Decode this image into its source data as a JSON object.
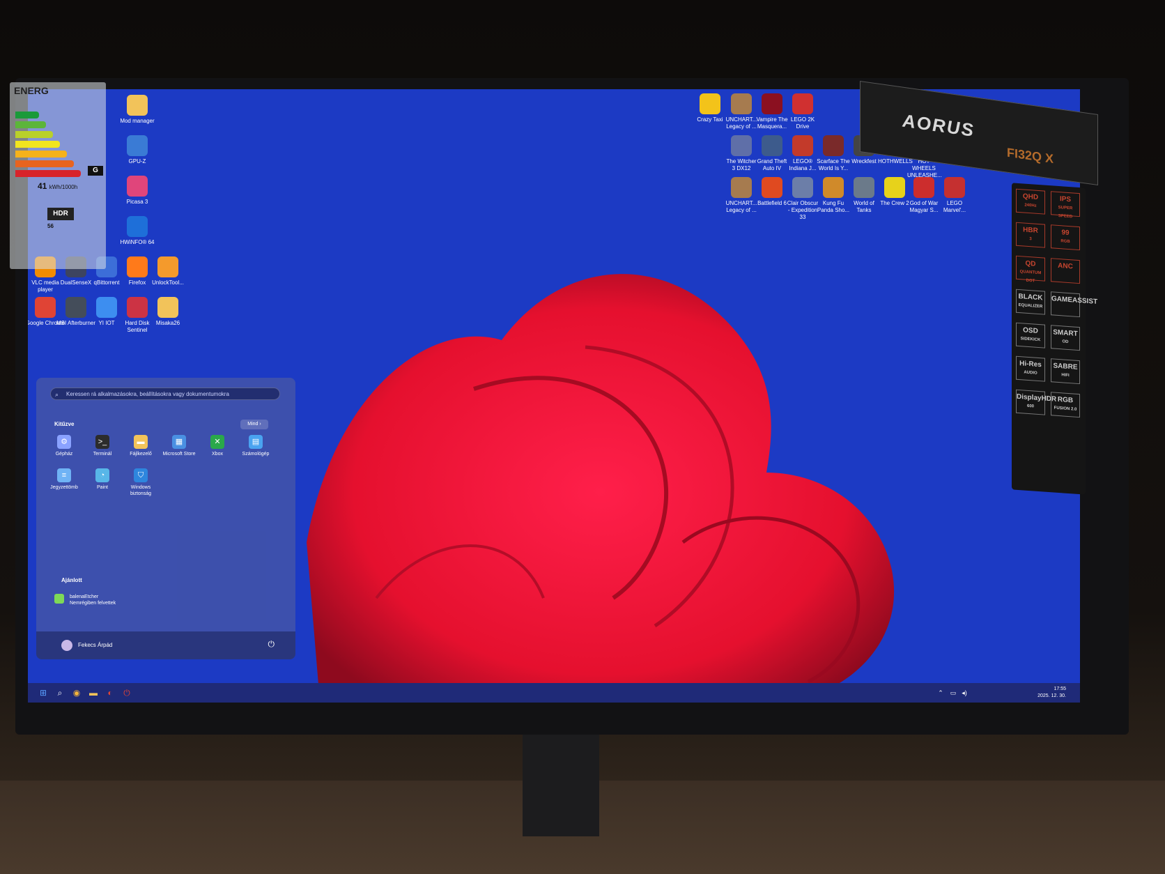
{
  "desktop_icons_left": [
    {
      "label": "Mod manager",
      "icon": "folder-icon",
      "color": "#f2c35a"
    },
    {
      "label": "GPU-Z",
      "icon": "gpuz-icon",
      "color": "#3a7bd5"
    },
    {
      "label": "Picasa 3",
      "icon": "picasa-icon",
      "color": "#e0457b"
    },
    {
      "label": "HWiNFO® 64",
      "icon": "hwinfo-icon",
      "color": "#1e6fd9"
    },
    {
      "label": "VLC media player",
      "icon": "vlc-icon",
      "color": "#f28c00"
    },
    {
      "label": "DualSenseX",
      "icon": "controller-icon",
      "color": "#3d4460"
    },
    {
      "label": "qBittorrent",
      "icon": "qbittorrent-icon",
      "color": "#3c6ed8"
    },
    {
      "label": "Firefox",
      "icon": "firefox-icon",
      "color": "#ff7a1a"
    },
    {
      "label": "UnlockTool...",
      "icon": "unlocktool-icon",
      "color": "#f49a2c"
    },
    {
      "label": "Google Chrome",
      "icon": "chrome-icon",
      "color": "#e04435"
    },
    {
      "label": "MSI Afterburner",
      "icon": "msi-icon",
      "color": "#444d5a"
    },
    {
      "label": "YI IOT",
      "icon": "yiiot-icon",
      "color": "#3d8ef0"
    },
    {
      "label": "Hard Disk Sentinel",
      "icon": "harddisk-icon",
      "color": "#cc3344"
    },
    {
      "label": "Misaka26",
      "icon": "folder-icon",
      "color": "#f2c35a"
    }
  ],
  "desktop_icons_right": [
    {
      "label": "Crazy Taxi",
      "color": "#f3c31a"
    },
    {
      "label": "UNCHART... Legacy of ...",
      "color": "#a67b4f"
    },
    {
      "label": "Vampire The Masquera...",
      "color": "#8b1020"
    },
    {
      "label": "LEGO 2K Drive",
      "color": "#d03030"
    },
    {
      "label": "The Witcher 3 DX12",
      "color": "#5f6fa8"
    },
    {
      "label": "Grand Theft Auto IV",
      "color": "#3d5b8c"
    },
    {
      "label": "LEGO® Indiana J...",
      "color": "#c33a2a"
    },
    {
      "label": "Scarface The World Is Y...",
      "color": "#7a2a2a"
    },
    {
      "label": "Wreckfest",
      "color": "#444"
    },
    {
      "label": "HOTHWELLS",
      "color": "#444"
    },
    {
      "label": "HOT WHEELS UNLEASHE...",
      "color": "#444"
    },
    {
      "label": "UNCHART... Legacy of ...",
      "color": "#a67b4f"
    },
    {
      "label": "Battlefield 6",
      "color": "#e04a20"
    },
    {
      "label": "Clair Obscur - Expedition 33",
      "color": "#6c7ea8"
    },
    {
      "label": "Kung Fu Panda Sho...",
      "color": "#d08a2a"
    },
    {
      "label": "World of Tanks",
      "color": "#6b7a8a"
    },
    {
      "label": "The Crew 2",
      "color": "#e7d21b"
    },
    {
      "label": "God of War Magyar S...",
      "color": "#cc2d2d"
    },
    {
      "label": "LEGO Marvel'...",
      "color": "#c53030"
    }
  ],
  "start_menu": {
    "search_placeholder": "Keressen rá alkalmazásokra, beállításokra vagy dokumentumokra",
    "pinned_title": "Kitűzve",
    "all_label": "Mind",
    "pinned": [
      {
        "label": "Gépház",
        "icon": "settings-icon",
        "glyph": "⚙",
        "color": "#8aa2ff"
      },
      {
        "label": "Terminál",
        "icon": "terminal-icon",
        "glyph": ">_",
        "color": "#2c2c2c"
      },
      {
        "label": "Fájlkezelő",
        "icon": "folder-icon",
        "glyph": "▬",
        "color": "#f2c35a"
      },
      {
        "label": "Microsoft Store",
        "icon": "store-icon",
        "glyph": "▦",
        "color": "#4a90e2"
      },
      {
        "label": "Xbox",
        "icon": "xbox-icon",
        "glyph": "✕",
        "color": "#2aa84a"
      },
      {
        "label": "Számológép",
        "icon": "calculator-icon",
        "glyph": "▤",
        "color": "#4aa3f0"
      },
      {
        "label": "Jegyzettömb",
        "icon": "notepad-icon",
        "glyph": "≡",
        "color": "#6fb3f5"
      },
      {
        "label": "Paint",
        "icon": "paint-icon",
        "glyph": "◔",
        "color": "#58b6e8"
      },
      {
        "label": "Windows biztonság",
        "icon": "shield-icon",
        "glyph": "⛉",
        "color": "#2e86de"
      }
    ],
    "recommended_title": "Ajánlott",
    "recommended": [
      {
        "title": "balenaEtcher",
        "subtitle": "Nemrégiben felvettek"
      }
    ],
    "user_name": "Fekecs Árpád"
  },
  "taskbar": {
    "time": "17:55",
    "date": "2025. 12. 30."
  },
  "energy_label": {
    "title": "ENERG",
    "class": "G",
    "kwh": "41",
    "kwh_unit": "kWh/1000h",
    "hdr": "HDR",
    "hdr_kwh": "56"
  },
  "box": {
    "brand": "AORUS",
    "model": "FI32Q X",
    "specs": [
      {
        "line1": "QHD",
        "line2": "240Hz"
      },
      {
        "line1": "IPS",
        "line2": "SUPER SPEED"
      },
      {
        "line1": "HBR",
        "line2": "3"
      },
      {
        "line1": "99",
        "line2": "RGB"
      },
      {
        "line1": "QD",
        "line2": "QUANTUM DOT"
      },
      {
        "line1": "ANC",
        "line2": ""
      },
      {
        "line1": "BLACK",
        "line2": "EQUALIZER"
      },
      {
        "line1": "GAMEASSIST",
        "line2": ""
      },
      {
        "line1": "OSD",
        "line2": "SIDEKICK"
      },
      {
        "line1": "SMART",
        "line2": "OD"
      },
      {
        "line1": "Hi-Res",
        "line2": "AUDIO"
      },
      {
        "line1": "SABRE",
        "line2": "HIFI"
      },
      {
        "line1": "DisplayHDR",
        "line2": "600"
      },
      {
        "line1": "RGB",
        "line2": "FUSION 2.0"
      }
    ]
  }
}
